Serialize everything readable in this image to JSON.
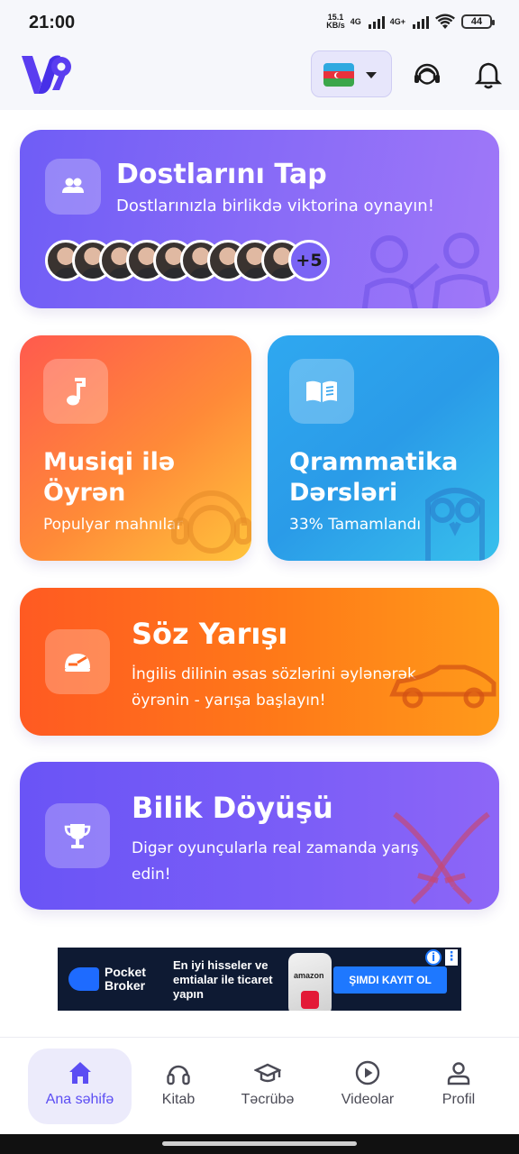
{
  "status_bar": {
    "time": "21:00",
    "speed_value": "15.1",
    "speed_unit": "KB/s",
    "net1": "4G",
    "net2": "4G+",
    "battery": "44"
  },
  "header": {
    "language_flag": "Azerbaijan flag",
    "icons": [
      "support-icon",
      "bell-icon"
    ]
  },
  "friends_card": {
    "title": "Dostlarını Tap",
    "subtitle": "Dostlarınızla birlikdə viktorina oynayın!",
    "more_count": "+5",
    "avatar_count": 9
  },
  "music_card": {
    "title": "Musiqi ilə Öyrən",
    "subtitle": "Populyar mahnılar"
  },
  "grammar_card": {
    "title": "Qrammatika Dərsləri",
    "subtitle": "33% Tamamlandı",
    "progress_percent": 33
  },
  "race_card": {
    "title": "Söz Yarışı",
    "subtitle": "İngilis dilinin əsas sözlərini əylənərək öyrənin - yarışa başlayın!"
  },
  "battle_card": {
    "title": "Bilik Döyüşü",
    "subtitle": "Digər oyunçularla real zamanda yarış edin!"
  },
  "ad": {
    "brand_line1": "Pocket",
    "brand_line2": "Broker",
    "text": "En iyi hisseler ve emtialar ile ticaret yapın",
    "cta": "ŞIMDI KAYIT OL",
    "phone_label": "amazon",
    "info": "i",
    "menu": "⋮"
  },
  "bottom_nav": {
    "items": [
      {
        "label": "Ana səhifə",
        "icon": "home-icon",
        "active": true
      },
      {
        "label": "Kitab",
        "icon": "headphones-icon",
        "active": false
      },
      {
        "label": "Təcrübə",
        "icon": "graduation-cap-icon",
        "active": false
      },
      {
        "label": "Videolar",
        "icon": "play-circle-icon",
        "active": false
      },
      {
        "label": "Profil",
        "icon": "user-icon",
        "active": false
      }
    ]
  },
  "colors": {
    "accent": "#5b4df3",
    "friends_bg": "#7a64f5",
    "music_bg": "#ff7a3c",
    "grammar_bg": "#2fa8f0",
    "race_bg": "#ff6a1e",
    "battle_bg": "#7159f6"
  }
}
